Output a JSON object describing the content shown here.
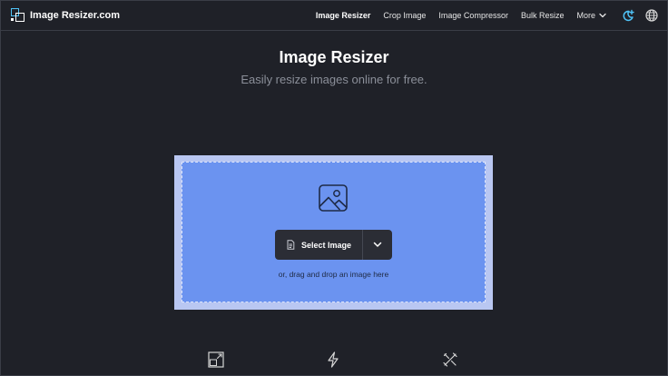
{
  "header": {
    "brand": "Image Resizer.com",
    "nav": [
      {
        "label": "Image Resizer",
        "active": true
      },
      {
        "label": "Crop Image",
        "active": false
      },
      {
        "label": "Image Compressor",
        "active": false
      },
      {
        "label": "Bulk Resize",
        "active": false
      }
    ],
    "more_label": "More",
    "icons": [
      "theme-toggle-icon",
      "globe-icon"
    ]
  },
  "hero": {
    "title": "Image Resizer",
    "subtitle": "Easily resize images online for free."
  },
  "upload": {
    "select_label": "Select Image",
    "drag_text": "or, drag and drop an image here",
    "icons": [
      "image-placeholder-icon",
      "file-icon",
      "chevron-down-icon"
    ]
  },
  "features": {
    "icons": [
      "resize-icon",
      "lightning-icon",
      "tools-icon"
    ]
  },
  "colors": {
    "background": "#1f2128",
    "upload_outer": "#b9c7f2",
    "upload_inner": "#6b93f0",
    "button": "#2b2d35",
    "accent": "#4fc3f7"
  }
}
